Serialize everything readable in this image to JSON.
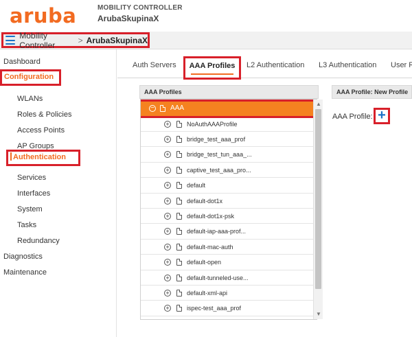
{
  "header": {
    "logo": "aruba",
    "product": "MOBILITY CONTROLLER",
    "hostname": "ArubaSkupinaX"
  },
  "breadcrumb": {
    "root": "Mobility Controller",
    "separator": ">",
    "current": "ArubaSkupinaX"
  },
  "sidebar": {
    "dashboard": "Dashboard",
    "configuration": "Configuration",
    "sub_items": [
      "WLANs",
      "Roles & Policies",
      "Access Points",
      "AP Groups",
      "Authentication",
      "Services",
      "Interfaces",
      "System",
      "Tasks",
      "Redundancy"
    ],
    "diagnostics": "Diagnostics",
    "maintenance": "Maintenance",
    "active": "Authentication"
  },
  "tabs": [
    "Auth Servers",
    "AAA Profiles",
    "L2 Authentication",
    "L3 Authentication",
    "User R"
  ],
  "active_tab": "AAA Profiles",
  "left_panel": {
    "title": "AAA Profiles",
    "root_node": "AAA",
    "items": [
      "NoAuthAAAProfile",
      "bridge_test_aaa_prof",
      "bridge_test_tun_aaa_...",
      "captive_test_aaa_pro...",
      "default",
      "default-dot1x",
      "default-dot1x-psk",
      "default-iap-aaa-prof...",
      "default-mac-auth",
      "default-open",
      "default-tunneled-use...",
      "default-xml-api",
      "ispec-test_aaa_prof"
    ]
  },
  "right_panel": {
    "title": "AAA Profile: New Profile",
    "field_label": "AAA Profile:",
    "add_symbol": "+"
  },
  "colors": {
    "brand": "#f26b21",
    "selected_row": "#f58220",
    "highlight_box": "#d8202a",
    "link_blue": "#1a73c8"
  }
}
